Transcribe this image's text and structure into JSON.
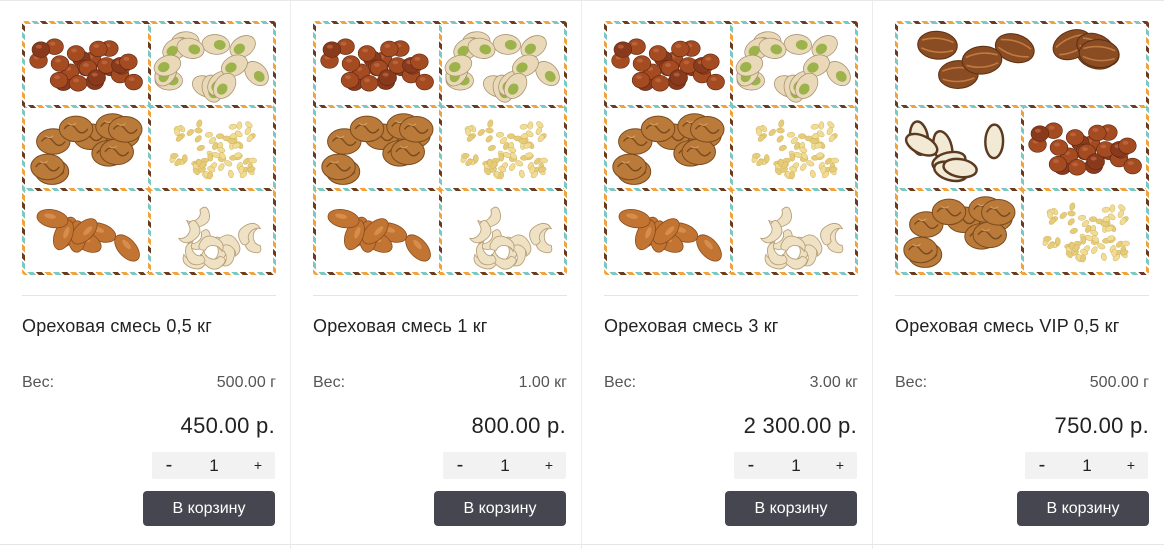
{
  "products": [
    {
      "title": "Ореховая смесь 0,5 кг",
      "weight_label": "Вес:",
      "weight": "500.00 г",
      "price": "450.00 р.",
      "qty_minus": "-",
      "qty": "1",
      "qty_plus": "+",
      "cart_label": "В корзину",
      "images": [
        "hazelnut",
        "pistachio",
        "walnut",
        "pine-nut",
        "almond",
        "cashew"
      ]
    },
    {
      "title": "Ореховая смесь 1 кг",
      "weight_label": "Вес:",
      "weight": "1.00 кг",
      "price": "800.00 р.",
      "qty_minus": "-",
      "qty": "1",
      "qty_plus": "+",
      "cart_label": "В корзину",
      "images": [
        "hazelnut",
        "pistachio",
        "walnut",
        "pine-nut",
        "almond",
        "cashew"
      ]
    },
    {
      "title": "Ореховая смесь 3 кг",
      "weight_label": "Вес:",
      "weight": "3.00 кг",
      "price": "2 300.00 р.",
      "qty_minus": "-",
      "qty": "1",
      "qty_plus": "+",
      "cart_label": "В корзину",
      "images": [
        "hazelnut",
        "pistachio",
        "walnut",
        "pine-nut",
        "almond",
        "cashew"
      ]
    },
    {
      "title": "Ореховая смесь VIP 0,5 кг",
      "weight_label": "Вес:",
      "weight": "500.00 г",
      "price": "750.00 р.",
      "qty_minus": "-",
      "qty": "1",
      "qty_plus": "+",
      "cart_label": "В корзину",
      "images": [
        "pecan",
        "brazil-nut",
        "hazelnut",
        "walnut",
        "pine-nut"
      ]
    }
  ],
  "colors": {
    "button_bg": "#45464f",
    "button_text": "#ffffff",
    "frame_orange": "#f0a23b",
    "frame_teal": "#7cc8c0",
    "frame_brown": "#6b3b1f"
  }
}
